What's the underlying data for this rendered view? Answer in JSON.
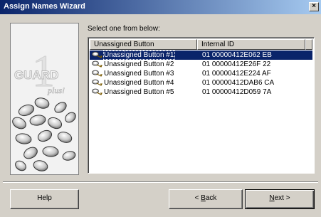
{
  "window": {
    "title": "Assign Names Wizard",
    "close_glyph": "×"
  },
  "side_panel": {
    "logo_text": "GUARD",
    "logo_digit": "1",
    "logo_subtext": "plus!"
  },
  "prompt": "Select one from below:",
  "list": {
    "columns": [
      "Unassigned Button",
      "Internal ID"
    ],
    "rows": [
      {
        "name": "Unassigned Button #1",
        "id": "01 00000412E062 EB",
        "selected": true
      },
      {
        "name": "Unassigned Button #2",
        "id": "01 00000412E26F 22",
        "selected": false
      },
      {
        "name": "Unassigned Button #3",
        "id": "01 00000412E224 AF",
        "selected": false
      },
      {
        "name": "Unassigned Button #4",
        "id": "01 00000412DAB6 CA",
        "selected": false
      },
      {
        "name": "Unassigned Button #5",
        "id": "01 00000412D059 7A",
        "selected": false
      }
    ],
    "row_icon": "ibutton-key-icon"
  },
  "buttons": {
    "help": "Help",
    "back_prefix": "< ",
    "back_key": "B",
    "back_rest": "ack",
    "next_key": "N",
    "next_rest": "ext >"
  },
  "colors": {
    "selection": "#0a246a",
    "face": "#d4d0c8"
  }
}
